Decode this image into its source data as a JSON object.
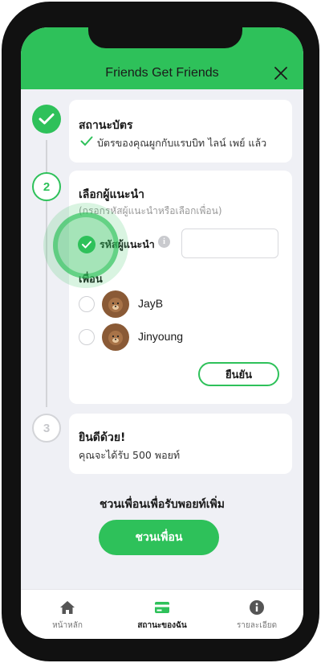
{
  "header": {
    "title": "Friends Get Friends"
  },
  "steps": {
    "step1": {
      "title": "สถานะบัตร",
      "status": "บัตรของคุณผูกกับแรบบิท ไลน์ เพย์ แล้ว"
    },
    "step2": {
      "number": "2",
      "title": "เลือกผู้แนะนำ",
      "subtitle": "(กรอกรหัสผู้แนะนำหรือเลือกเพื่อน)",
      "code_label": "รหัสผู้แนะนำ",
      "code_value": "",
      "friends_label": "เพื่อน",
      "friends": [
        {
          "name": "JayB"
        },
        {
          "name": "Jinyoung"
        }
      ],
      "confirm_label": "ยืนยัน"
    },
    "step3": {
      "number": "3",
      "title": "ยินดีด้วย!",
      "text": "คุณจะได้รับ 500 พอยท์"
    }
  },
  "invite": {
    "text": "ชวนเพื่อนเพื่อรับพอยท์เพิ่ม",
    "button_label": "ชวนเพื่อน"
  },
  "tabs": [
    {
      "label": "หน้าหลัก",
      "icon": "home-icon"
    },
    {
      "label": "สถานะของฉัน",
      "icon": "card-icon",
      "active": true
    },
    {
      "label": "รายละเอียด",
      "icon": "info-icon"
    }
  ],
  "colors": {
    "accent": "#2ec15a",
    "background": "#eff0f5"
  }
}
